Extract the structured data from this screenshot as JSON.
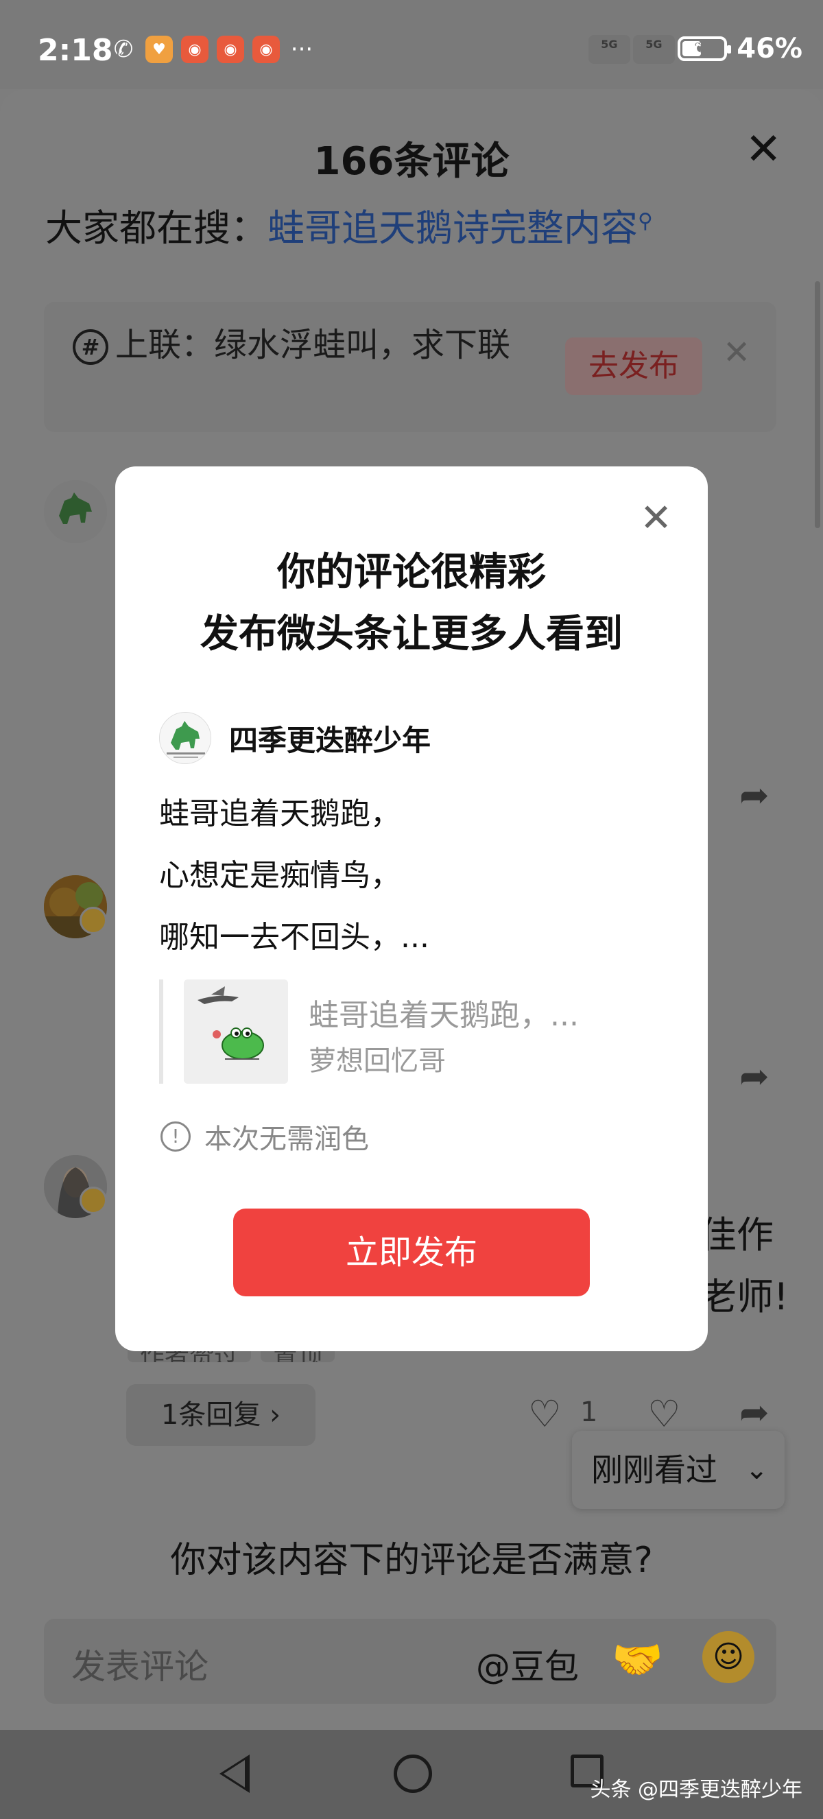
{
  "status": {
    "time": "2:18",
    "battery": "46%",
    "battery_level": 0.46,
    "network_1": "5G",
    "network_2": "5G"
  },
  "panel": {
    "title": "166条评论",
    "search_prefix": "大家都在搜：",
    "search_query": "蛙哥追天鹅诗完整内容",
    "topic_text": "上联：绿水浮蛙叫，求下联",
    "topic_button": "去发布",
    "behind_line1": "佳作",
    "behind_line2": "老师!",
    "tags": [
      "作者赞过",
      "置顶"
    ],
    "reply_count": "1条回复",
    "like_count": "1",
    "recently_viewed": "刚刚看过",
    "survey": "你对该内容下的评论是否满意?",
    "comment_placeholder": "发表评论",
    "mention": "@豆包"
  },
  "modal": {
    "title_line1": "你的评论很精彩",
    "title_line2": "发布微头条让更多人看到",
    "author": "四季更迭醉少年",
    "poem_lines": [
      "蛙哥追着天鹅跑，",
      "心想定是痴情鸟，",
      "哪知一去不回头，..."
    ],
    "quote_text": "蛙哥追着天鹅跑，...",
    "quote_author": "萝想回忆哥",
    "notice": "本次无需润色",
    "publish_button": "立即发布"
  },
  "watermark": "头条 @四季更迭醉少年",
  "colors": {
    "accent_red": "#f0423f",
    "link_blue": "#1f3f7a"
  },
  "icons": [
    "missed-call-icon",
    "heart-app-icon",
    "kuaishou-icon",
    "signal-icon",
    "battery-icon",
    "close-icon",
    "search-icon",
    "hashtag-icon",
    "share-icon",
    "like-icon",
    "dislike-icon",
    "chevron-down-icon",
    "handshake-icon",
    "party-emoji-icon",
    "info-icon",
    "back-icon",
    "home-icon",
    "recents-icon"
  ]
}
